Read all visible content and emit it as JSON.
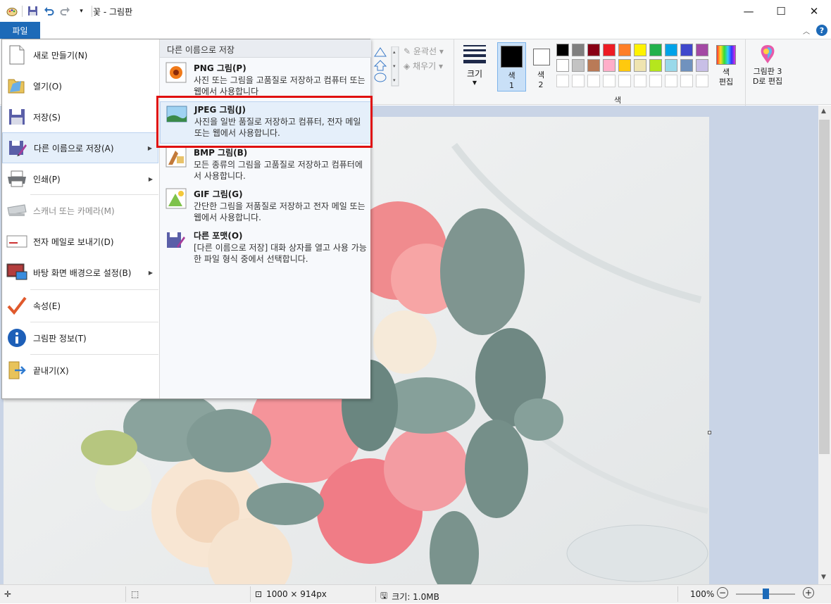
{
  "window": {
    "title": "꽃 - 그림판",
    "minimize": "—",
    "maximize": "☐",
    "close": "✕"
  },
  "ribbon": {
    "file_tab": "파일",
    "outline_label": "윤곽선",
    "fill_label": "채우기",
    "size_label": "크기",
    "color1_label": "색\n1",
    "color2_label": "색\n2",
    "colors_group": "색",
    "edit_colors_label": "색\n편집",
    "paint3d_label": "그림판 3\nD로 편집",
    "color1": "#000000",
    "color2": "#ffffff",
    "palette": [
      "#000000",
      "#7f7f7f",
      "#880015",
      "#ed1c24",
      "#ff7f27",
      "#fff200",
      "#22b14c",
      "#00a2e8",
      "#3f48cc",
      "#a349a4",
      "#ffffff",
      "#c3c3c3",
      "#b97a57",
      "#ffaec9",
      "#ffc90e",
      "#efe4b0",
      "#b5e61d",
      "#99d9ea",
      "#7092be",
      "#c8bfe7",
      "#ffffff",
      "#ffffff",
      "#ffffff",
      "#ffffff",
      "#ffffff",
      "#ffffff",
      "#ffffff",
      "#ffffff",
      "#ffffff",
      "#ffffff"
    ]
  },
  "filemenu": {
    "items": [
      {
        "label": "새로 만들기(N)",
        "icon": "new-document-icon"
      },
      {
        "label": "열기(O)",
        "icon": "open-folder-icon"
      },
      {
        "label": "저장(S)",
        "icon": "save-disk-icon"
      },
      {
        "label": "다른 이름으로 저장(A)",
        "icon": "save-as-icon"
      },
      {
        "label": "인쇄(P)",
        "icon": "printer-icon"
      },
      {
        "label": "스캐너 또는 카메라(M)",
        "icon": "scanner-icon"
      },
      {
        "label": "전자 메일로 보내기(D)",
        "icon": "email-icon"
      },
      {
        "label": "바탕 화면 배경으로 설정(B)",
        "icon": "desktop-background-icon"
      },
      {
        "label": "속성(E)",
        "icon": "checkmark-icon"
      },
      {
        "label": "그림판 정보(T)",
        "icon": "info-icon"
      },
      {
        "label": "끝내기(X)",
        "icon": "exit-icon"
      }
    ],
    "saveas_header": "다른 이름으로 저장",
    "saveas_options": [
      {
        "title": "PNG 그림(P)",
        "desc": "사진 또는 그림을 고품질로 저장하고 컴퓨터 또는 웹에서 사용합니다",
        "icon": "png-image-icon"
      },
      {
        "title": "JPEG 그림(J)",
        "desc": "사진을 일반 품질로 저장하고 컴퓨터, 전자 메일 또는 웹에서 사용합니다.",
        "icon": "jpeg-image-icon"
      },
      {
        "title": "BMP 그림(B)",
        "desc": "모든 종류의 그림을 고품질로 저장하고 컴퓨터에서 사용합니다.",
        "icon": "bmp-image-icon"
      },
      {
        "title": "GIF 그림(G)",
        "desc": "간단한 그림을 저품질로 저장하고 전자 메일 또는 웹에서 사용합니다.",
        "icon": "gif-image-icon"
      },
      {
        "title": "다른 포맷(O)",
        "desc": "[다른 이름으로 저장] 대화 상자를 열고 사용 가능한 파일 형식 중에서 선택합니다.",
        "icon": "other-format-icon"
      }
    ]
  },
  "status": {
    "dimensions": "1000 × 914px",
    "filesize": "크기: 1.0MB",
    "zoom": "100%",
    "zoom_minus": "−",
    "zoom_plus": "+"
  }
}
